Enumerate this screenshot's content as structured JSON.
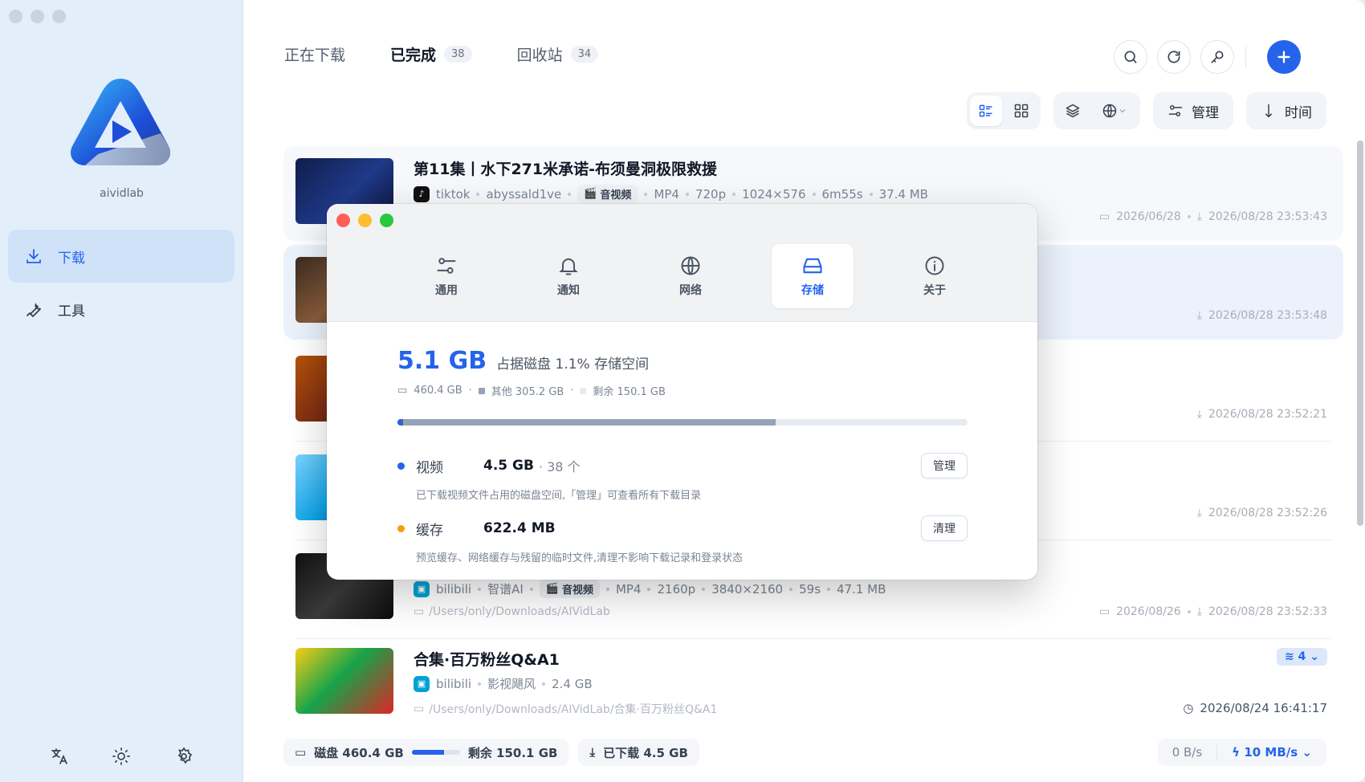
{
  "app": {
    "name": "aividlab"
  },
  "sidebar": {
    "items": [
      {
        "label": "下载",
        "icon": "download-icon",
        "active": true
      },
      {
        "label": "工具",
        "icon": "wrench-icon",
        "active": false
      }
    ],
    "bottom_icons": [
      "translate-icon",
      "sun-icon",
      "gear-icon"
    ]
  },
  "tabs": [
    {
      "label": "正在下载",
      "count": ""
    },
    {
      "label": "已完成",
      "count": "38"
    },
    {
      "label": "回收站",
      "count": "34"
    }
  ],
  "toolbar": {
    "manage_label": "管理",
    "sort_label": "时间"
  },
  "list": [
    {
      "title": "第11集丨水下271米承诺-布须曼洞极限救援",
      "platform": "tiktok",
      "uploader": "abyssald1ve",
      "kind": "音视频",
      "format": "MP4",
      "quality": "720p",
      "resolution": "1024×576",
      "duration": "6m55s",
      "size": "37.4 MB",
      "published": "2026/06/28",
      "downloaded": "2026/08/28 23:53:43"
    },
    {
      "downloaded": "2026/08/28 23:53:48"
    },
    {
      "downloaded": "2026/08/28 23:52:21"
    },
    {
      "downloaded": "2026/08/28 23:52:26"
    },
    {
      "platform": "bilibili",
      "uploader": "智谱AI",
      "kind": "音视频",
      "format": "MP4",
      "quality": "2160p",
      "resolution": "3840×2160",
      "duration": "59s",
      "size": "47.1 MB",
      "path": "/Users/only/Downloads/AIVidLab",
      "published": "2026/08/26",
      "downloaded": "2026/08/28 23:52:33"
    },
    {
      "title": "合集·百万粉丝Q&A1",
      "platform": "bilibili",
      "uploader": "影视飓风",
      "size": "2.4 GB",
      "path": "/Users/only/Downloads/AIVidLab/合集·百万粉丝Q&A1",
      "downloaded": "2026/08/24 16:41:17",
      "count": "4"
    }
  ],
  "status": {
    "disk_label": "磁盘 460.4 GB",
    "disk_used_fraction": 0.67,
    "free_label": "剩余 150.1 GB",
    "downloaded_label": "已下载 4.5 GB",
    "speed_current": "0 B/s",
    "speed_limit": "10 MB/s"
  },
  "dialog": {
    "tabs": [
      {
        "label": "通用",
        "icon": "sliders-icon"
      },
      {
        "label": "通知",
        "icon": "bell-icon"
      },
      {
        "label": "网络",
        "icon": "globe-icon"
      },
      {
        "label": "存储",
        "icon": "drive-icon",
        "active": true
      },
      {
        "label": "关于",
        "icon": "info-icon"
      }
    ],
    "total": "5.1 GB",
    "total_caption": "占据磁盘 1.1% 存储空间",
    "disk_total": "460.4 GB",
    "other": "其他 305.2 GB",
    "free": "剩余 150.1 GB",
    "bar": {
      "video_fraction": 0.0098,
      "cache_fraction": 0.0013,
      "other_fraction": 0.663
    },
    "categories": [
      {
        "name": "视频",
        "size": "4.5 GB",
        "count": "· 38 个",
        "button": "管理",
        "desc": "已下载视频文件占用的磁盘空间,「管理」可查看所有下载目录",
        "color": "#2563eb"
      },
      {
        "name": "缓存",
        "size": "622.4 MB",
        "count": "",
        "button": "清理",
        "desc": "预览缓存、网络缓存与残留的临时文件,清理不影响下载记录和登录状态",
        "color": "#f59e0b"
      }
    ]
  },
  "colors": {
    "accent": "#2563eb",
    "sidebar_bg": "#e3eefb"
  }
}
